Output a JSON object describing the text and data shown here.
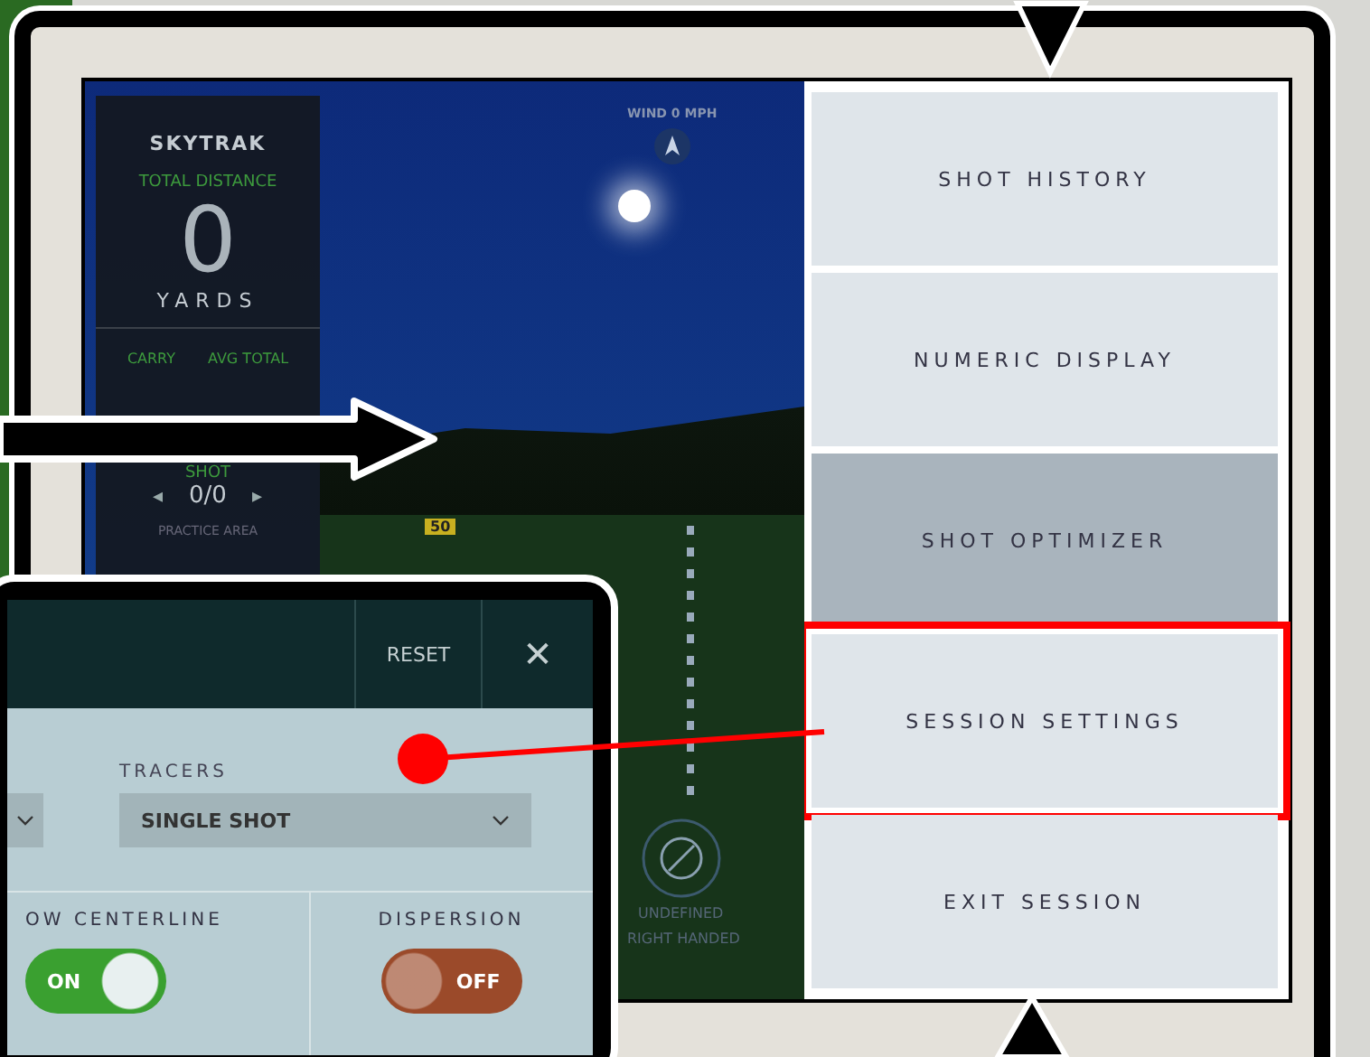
{
  "stats_panel": {
    "logo": "SKYTRAK",
    "total_distance_label": "TOTAL DISTANCE",
    "total_distance": "0",
    "unit": "YARDS",
    "carry_label": "CARRY",
    "avg_total_label": "AVG TOTAL",
    "shot_label": "SHOT",
    "shot_prev": "◂",
    "shot_count": "0/0",
    "shot_next": "▸",
    "practice_area": "PRACTICE AREA"
  },
  "scene": {
    "wind": "WIND 0 MPH",
    "yard_marker": "50",
    "handedness_top": "UNDEFINED",
    "handedness_bottom": "RIGHT HANDED"
  },
  "menu": [
    {
      "label": "SHOT HISTORY",
      "selected": false,
      "callout": false
    },
    {
      "label": "NUMERIC DISPLAY",
      "selected": false,
      "callout": false
    },
    {
      "label": "SHOT OPTIMIZER",
      "selected": true,
      "callout": false
    },
    {
      "label": "SESSION SETTINGS",
      "selected": false,
      "callout": true
    },
    {
      "label": "EXIT SESSION",
      "selected": false,
      "callout": false
    }
  ],
  "settings": {
    "reset": "RESET",
    "close": "✕",
    "tracers_label": "TRACERS",
    "tracers_value": "SINGLE SHOT",
    "toggles": [
      {
        "label": "OW CENTERLINE",
        "on": true,
        "text": "ON"
      },
      {
        "label": "DISPERSION",
        "on": false,
        "text": "OFF"
      }
    ]
  }
}
